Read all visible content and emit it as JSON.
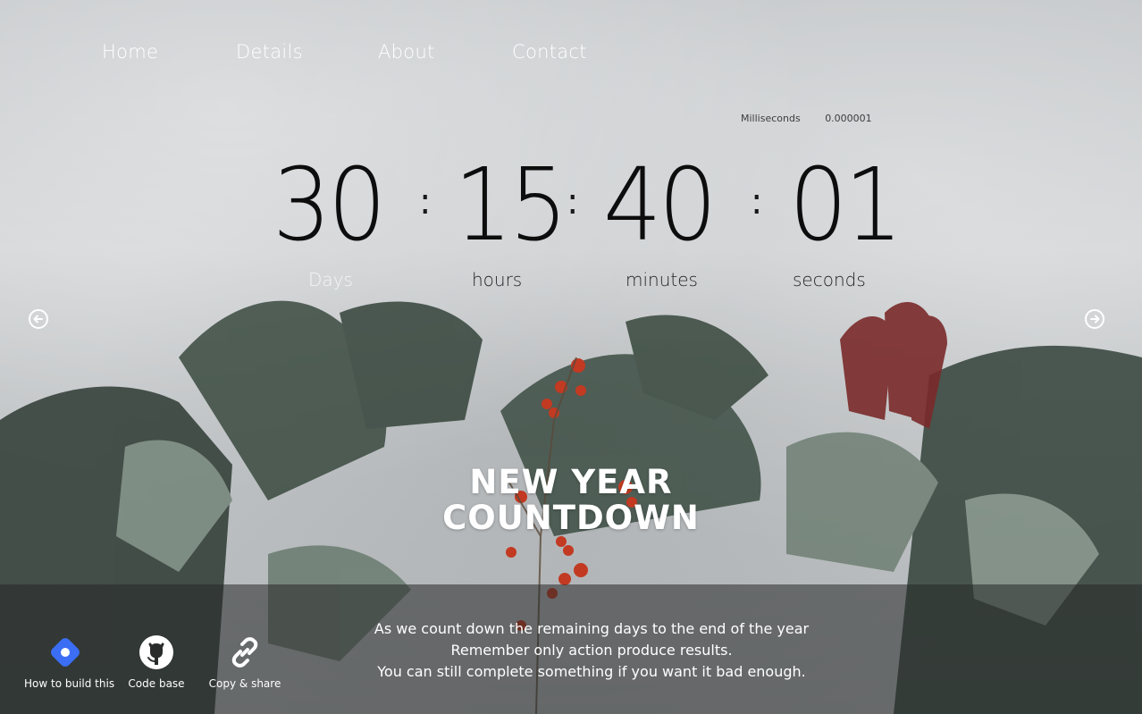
{
  "nav": {
    "items": [
      {
        "label": "Home"
      },
      {
        "label": "Details"
      },
      {
        "label": "About"
      },
      {
        "label": "Contact"
      }
    ]
  },
  "milliseconds": {
    "label": "Milliseconds",
    "value": "0.000001"
  },
  "countdown": {
    "days": "30",
    "hours": "15",
    "minutes": "40",
    "seconds": "01",
    "separator": ":",
    "labels": {
      "days": "Days",
      "hours": "hours",
      "minutes": "minutes",
      "seconds": "seconds"
    }
  },
  "headline": {
    "line1": "NEW YEAR",
    "line2": "COUNTDOWN"
  },
  "message": {
    "line1": "As we count down the remaining days to the end of the year",
    "line2": "Remember only action produce results.",
    "line3": "You can still complete something if you want it bad enough."
  },
  "tools": [
    {
      "label": "How to build this",
      "icon": "diamond-dot-icon",
      "color": "#3b6ef5"
    },
    {
      "label": "Code base",
      "icon": "github-icon"
    },
    {
      "label": "Copy & share",
      "icon": "link-icon"
    }
  ],
  "arrows": {
    "prev_icon": "arrow-left-circle-icon",
    "next_icon": "arrow-right-circle-icon"
  }
}
